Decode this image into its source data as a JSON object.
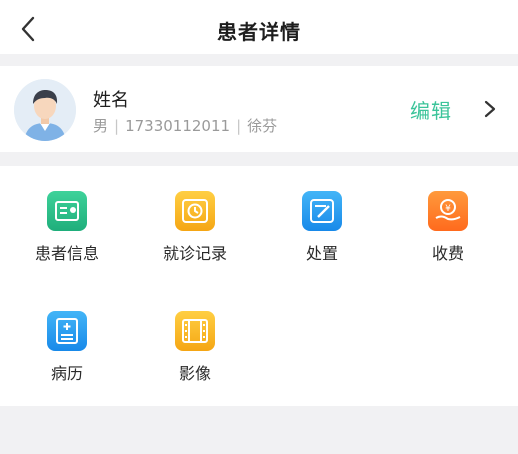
{
  "header": {
    "title": "患者详情"
  },
  "patient": {
    "name": "姓名",
    "gender": "男",
    "phone": "17330112011",
    "doctor": "徐芬",
    "separator": "|"
  },
  "actions": {
    "edit_label": "编辑"
  },
  "menu": [
    {
      "label": "患者信息",
      "icon": "patient-info-icon"
    },
    {
      "label": "就诊记录",
      "icon": "visit-record-icon"
    },
    {
      "label": "处置",
      "icon": "treatment-icon"
    },
    {
      "label": "收费",
      "icon": "charge-icon"
    },
    {
      "label": "病历",
      "icon": "medical-record-icon"
    },
    {
      "label": "影像",
      "icon": "imaging-icon"
    }
  ],
  "colors": {
    "accent": "#3cc49a",
    "background": "#f1f1f3"
  }
}
